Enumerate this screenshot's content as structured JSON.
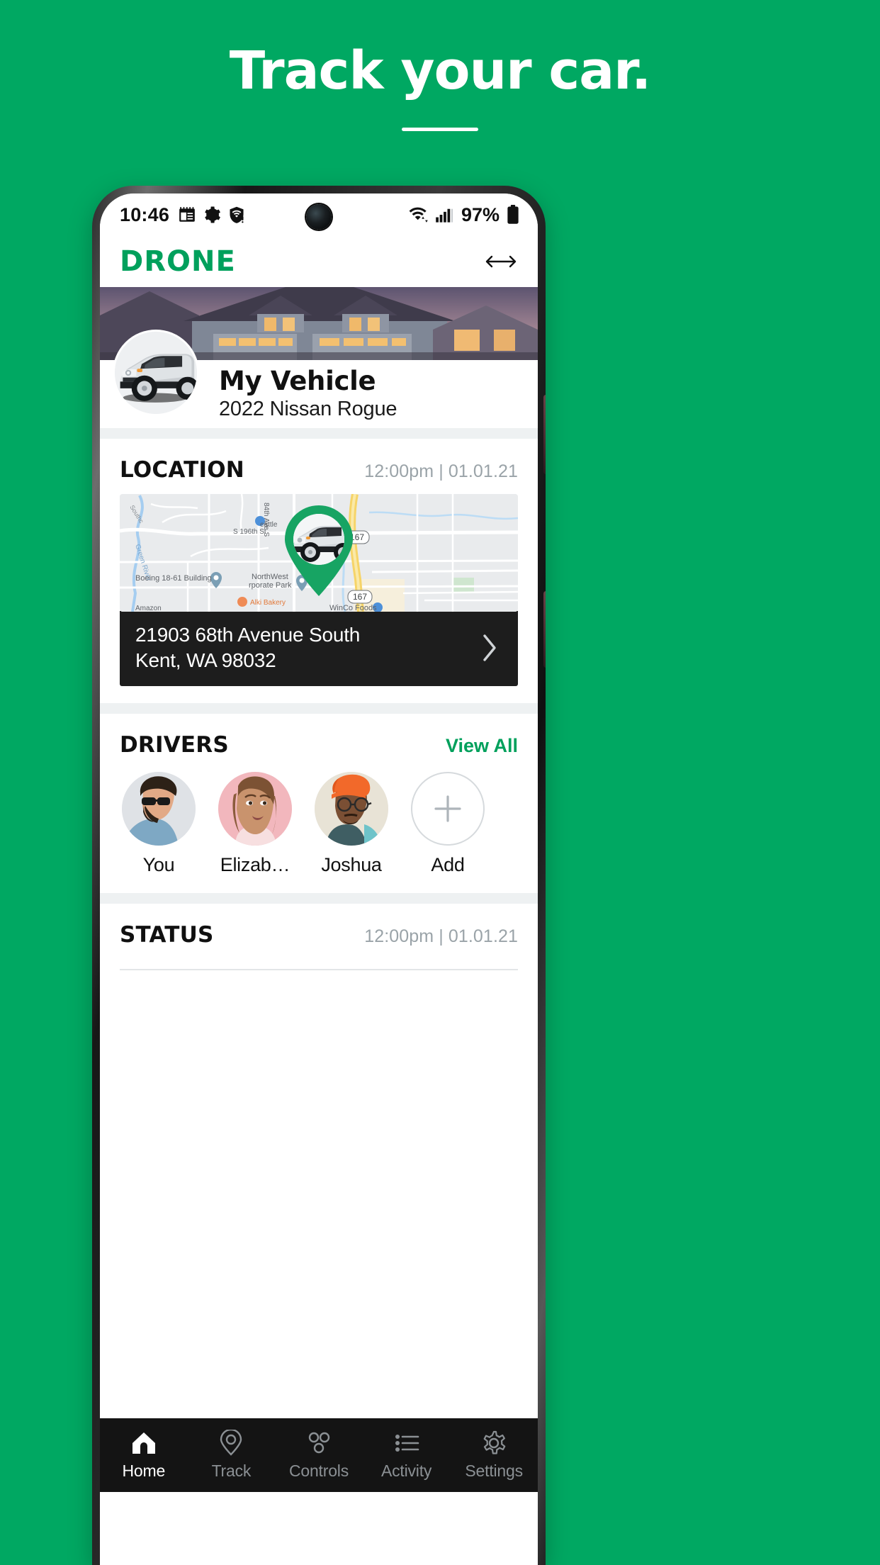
{
  "promo": {
    "title": "Track your car."
  },
  "brand_color": "#00A05C",
  "accent_color": "#00A862",
  "status_bar": {
    "time": "10:46",
    "left_icons": [
      "calendar-icon",
      "gear-icon",
      "shield-wifi-icon"
    ],
    "wifi_icon": "wifi-icon",
    "signal_icon": "cellular-signal-icon",
    "battery_percent": "97%",
    "battery_icon": "battery-full-icon"
  },
  "header": {
    "brand": "DRONE",
    "right_icon": "left-right-arrow-icon"
  },
  "vehicle": {
    "name": "My Vehicle",
    "model": "2022 Nissan Rogue"
  },
  "location": {
    "title": "LOCATION",
    "timestamp": "12:00pm | 01.01.21",
    "address_line1": "21903 68th Avenue South",
    "address_line2": "Kent, WA 98032",
    "chevron_icon": "chevron-right-icon",
    "map_labels": {
      "river": "Green River",
      "southcenter": "Southc",
      "street_196": "S 196th St",
      "boeing": "Boeing 18-61 Building",
      "bakery": "Alki Bakery",
      "amazon": "Amazon",
      "seattle": "eattle",
      "ave_84": "84th Ave S",
      "corporate_park_1": "NorthWest",
      "corporate_park_2": "rporate Park",
      "winco": "WinCo Foods",
      "highway_1": "167",
      "highway_2": "167"
    }
  },
  "drivers": {
    "title": "DRIVERS",
    "view_all": "View All",
    "items": [
      {
        "name": "You",
        "avatar": "avatar-man-sunglasses",
        "bg": "#dfe2e6"
      },
      {
        "name": "Elizab…",
        "avatar": "avatar-woman-pink",
        "bg": "#f2b7bd"
      },
      {
        "name": "Joshua",
        "avatar": "avatar-man-beanie",
        "bg": "#e8e3d6"
      },
      {
        "name": "Add",
        "avatar": "plus-icon",
        "bg": "#ffffff"
      }
    ]
  },
  "status": {
    "title": "STATUS",
    "timestamp": "12:00pm | 01.01.21"
  },
  "bottom_nav": {
    "items": [
      {
        "label": "Home",
        "icon": "home-icon",
        "active": true
      },
      {
        "label": "Track",
        "icon": "map-pin-icon",
        "active": false
      },
      {
        "label": "Controls",
        "icon": "controls-dots-icon",
        "active": false
      },
      {
        "label": "Activity",
        "icon": "list-icon",
        "active": false
      },
      {
        "label": "Settings",
        "icon": "gear-icon",
        "active": false
      }
    ]
  }
}
